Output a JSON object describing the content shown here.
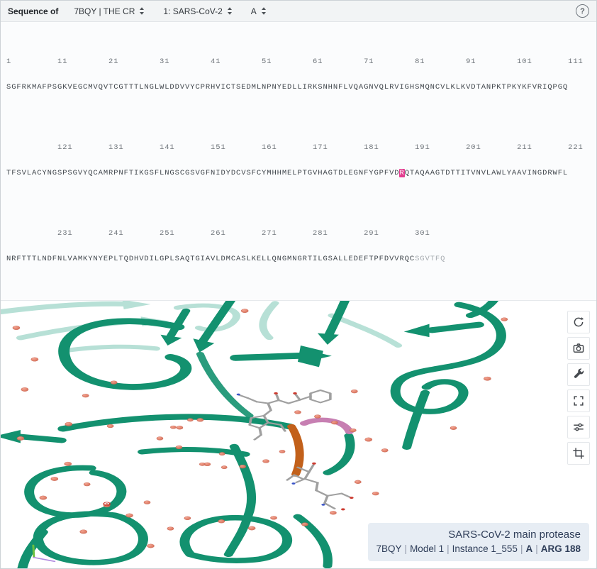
{
  "topbar": {
    "label": "Sequence of",
    "structure_select": "7BQY | THE CR",
    "entity_select": "1: SARS-CoV-2",
    "chain_select": "A",
    "help_symbol": "?"
  },
  "sequence": {
    "rows": [
      {
        "numbers": "1         11        21        31        41        51        61        71        81        91        101       111",
        "pre": "SGFRKMAFPSGKVEGCMVQVTCGTTTLNGLWLDDVVYCPRHVICTSEDMLNPNYEDLLIRKSNHNFLVQAGNVQLRVIGHSMQNCVLKLKVDTANPKTPKYKFVRIQPGQ"
      },
      {
        "numbers": "          121       131       141       151       161       171       181       191       201       211       221",
        "pre": "TFSVLACYNGSPSGVYQCAMRPNFTIKGSFLNGSCGSVGFNIDYDCVSFCYMHHMELPTGVHAGTDLEGNFYGPFVD",
        "highlight": "R",
        "post": "QTAQAAGTDTTITVNVLAWLYAAVINGDRWFL"
      },
      {
        "numbers": "          231       241       251       261       271       281       291       301",
        "pre": "NRFTTTLNDFNLVAMKYNYEPLTQDHVDILGPLSAQTGIAVLDMCASLKELLQNGMNGRTILGSALLEDEFTPFDVVRQC",
        "tail": "SGVTFQ"
      }
    ]
  },
  "viewport_toolbar": {
    "buttons": [
      "reset-camera",
      "screenshot",
      "toggle-controls",
      "expand-viewport",
      "settings",
      "selection-mode"
    ]
  },
  "info_box": {
    "title": "SARS-CoV-2 main protease",
    "pdb_id": "7BQY",
    "model": "Model 1",
    "instance": "Instance 1_555",
    "chain": "A",
    "residue": "ARG 188",
    "separator": "|"
  },
  "colors": {
    "ribbon_teal": "#13916F",
    "ribbon_faint": "#2ea78a",
    "water_red": "#e07a63",
    "ligand_gray": "#a0a0a0",
    "oxygen_red": "#cc3a2f",
    "nitrogen_blue": "#3b55c8",
    "sulfur_yellow": "#d4c422",
    "highlight_orange": "#c2601a",
    "highlight_pink": "#c77fb2",
    "sequence_highlight": "#e23d8f",
    "axis_green": "#6cbf3f",
    "axis_purple": "#b18ae0"
  }
}
